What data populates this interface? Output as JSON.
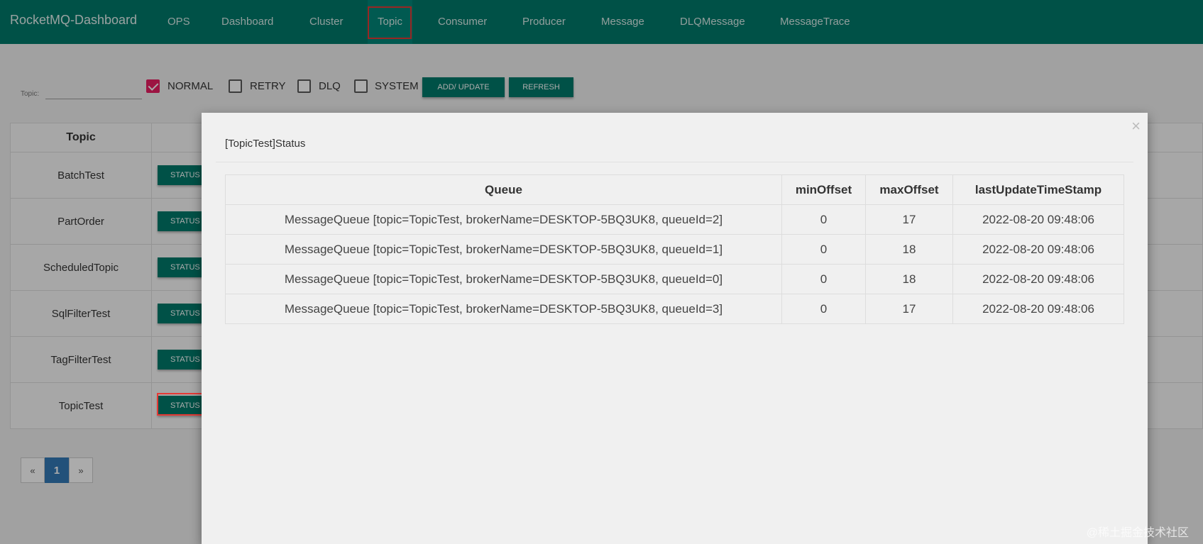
{
  "navbar": {
    "brand": "RocketMQ-Dashboard",
    "items": [
      "OPS",
      "Dashboard",
      "Cluster",
      "Topic",
      "Consumer",
      "Producer",
      "Message",
      "DLQMessage",
      "MessageTrace"
    ],
    "active": "Topic"
  },
  "filter": {
    "topic_label": "Topic:",
    "topic_value": "",
    "checkboxes": [
      {
        "label": "NORMAL",
        "checked": true
      },
      {
        "label": "RETRY",
        "checked": false
      },
      {
        "label": "DLQ",
        "checked": false
      },
      {
        "label": "SYSTEM",
        "checked": false
      }
    ],
    "add_update_label": "ADD/ UPDATE",
    "refresh_label": "REFRESH"
  },
  "topic_table": {
    "header": "Topic",
    "rows": [
      "BatchTest",
      "PartOrder",
      "ScheduledTopic",
      "SqlFilterTest",
      "TagFilterTest",
      "TopicTest"
    ],
    "status_label": "STATUS"
  },
  "pagination": {
    "prev": "«",
    "page": "1",
    "next": "»"
  },
  "modal": {
    "title": "[TopicTest]Status",
    "close": "×",
    "columns": [
      "Queue",
      "minOffset",
      "maxOffset",
      "lastUpdateTimeStamp"
    ],
    "rows": [
      [
        "MessageQueue [topic=TopicTest, brokerName=DESKTOP-5BQ3UK8, queueId=2]",
        "0",
        "17",
        "2022-08-20 09:48:06"
      ],
      [
        "MessageQueue [topic=TopicTest, brokerName=DESKTOP-5BQ3UK8, queueId=1]",
        "0",
        "18",
        "2022-08-20 09:48:06"
      ],
      [
        "MessageQueue [topic=TopicTest, brokerName=DESKTOP-5BQ3UK8, queueId=0]",
        "0",
        "18",
        "2022-08-20 09:48:06"
      ],
      [
        "MessageQueue [topic=TopicTest, brokerName=DESKTOP-5BQ3UK8, queueId=3]",
        "0",
        "17",
        "2022-08-20 09:48:06"
      ]
    ]
  },
  "watermark": "@稀土掘金技术社区",
  "colors": {
    "primary": "#00796b",
    "checked": "#e91e63",
    "highlight": "#e53935",
    "page_active": "#337ab7"
  }
}
